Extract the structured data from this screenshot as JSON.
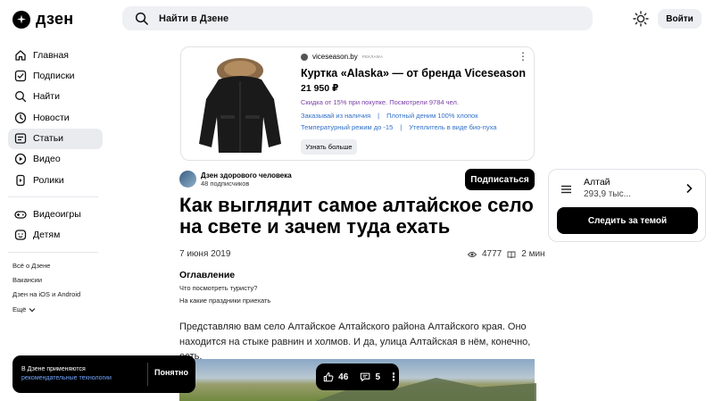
{
  "header": {
    "logo_text": "дзен",
    "search_placeholder": "Найти в Дзене",
    "login_label": "Войти"
  },
  "sidebar": {
    "items": [
      {
        "label": "Главная",
        "icon": "home-icon"
      },
      {
        "label": "Подписки",
        "icon": "subscriptions-icon"
      },
      {
        "label": "Найти",
        "icon": "search-icon"
      },
      {
        "label": "Новости",
        "icon": "news-icon"
      },
      {
        "label": "Статьи",
        "icon": "articles-icon",
        "active": true
      },
      {
        "label": "Видео",
        "icon": "video-icon"
      },
      {
        "label": "Ролики",
        "icon": "shorts-icon"
      }
    ],
    "items2": [
      {
        "label": "Видеоигры",
        "icon": "gamepad-icon"
      },
      {
        "label": "Детям",
        "icon": "kids-icon"
      }
    ],
    "links": [
      "Всё о Дзене",
      "Вакансии",
      "Дзен на iOS и Android",
      "Ещё"
    ]
  },
  "ad": {
    "source": "viceseason.by",
    "label": "реклама",
    "title": "Куртка «Alaska» — от бренда Viceseason",
    "price": "21 950 ₽",
    "promo": "Скидка от 15% при покупке. Посмотрели 9784 чел.",
    "features_row1": [
      "Заказывай из наличия",
      "Плотный деним 100% хлопок"
    ],
    "features_row2": [
      "Температурный режим до -15",
      "Утеплитель в виде био-пуха"
    ],
    "button_label": "Узнать больше"
  },
  "article": {
    "channel_name": "Дзен здорового человека",
    "channel_subscribers": "48 подписчиков",
    "subscribe_label": "Подписаться",
    "title": "Как выглядит самое алтайское село на свете и зачем туда ехать",
    "date": "7 июня 2019",
    "views": "4777",
    "read_time": "2 мин",
    "toc_title": "Оглавление",
    "toc_items": [
      "Что посмотреть туристу?",
      "На какие праздники приехать"
    ],
    "body": "Представляю вам село Алтайское Алтайского района Алтайского края. Оно находится на стыке равнин и холмов. И да, улица Алтайская в нём, конечно, есть."
  },
  "tag_card": {
    "name": "Алтай",
    "count": "293,9 тыс...",
    "follow_label": "Следить за темой"
  },
  "cookie": {
    "text": "В Дзене применяются",
    "link": "рекомендательные технологии",
    "button": "Понятно"
  },
  "actions": {
    "likes": "46",
    "comments": "5"
  }
}
